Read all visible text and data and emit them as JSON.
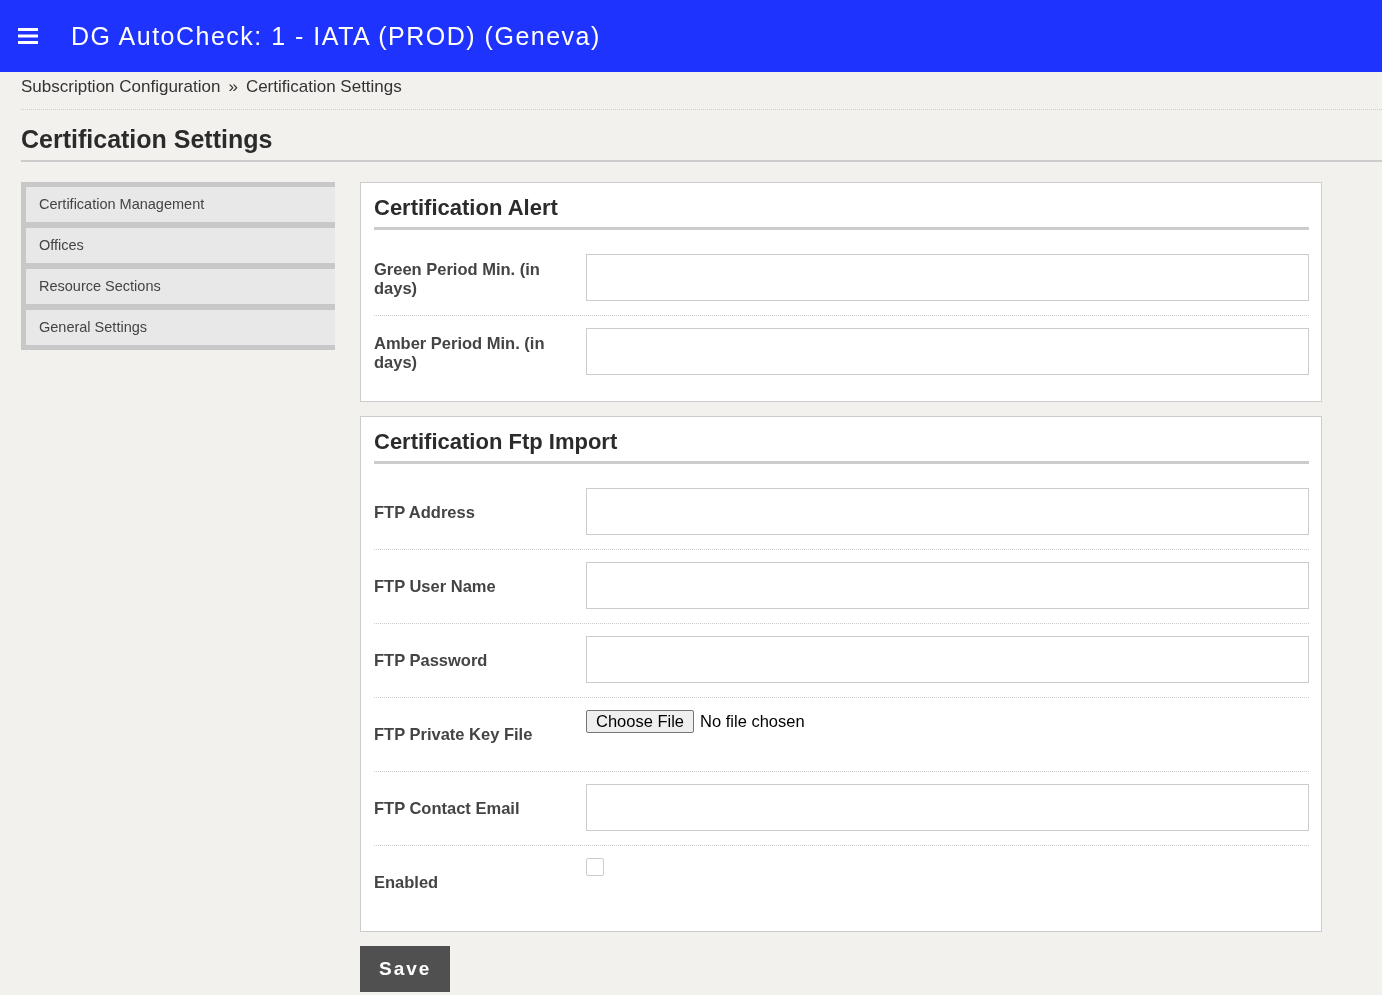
{
  "header": {
    "title": "DG AutoCheck: 1 - IATA (PROD) (Geneva)"
  },
  "breadcrumb": [
    {
      "label": "Subscription Configuration"
    },
    {
      "label": "»"
    },
    {
      "label": "Certification Settings"
    }
  ],
  "page_title": "Certification Settings",
  "sidebar": {
    "items": [
      {
        "label": "Certification Management"
      },
      {
        "label": "Offices"
      },
      {
        "label": "Resource Sections"
      },
      {
        "label": "General Settings"
      }
    ]
  },
  "sections": [
    {
      "title": "Certification Alert",
      "fields": [
        {
          "kind": "text",
          "label": "Green Period Min. (in days)"
        },
        {
          "kind": "text",
          "label": "Amber Period Min. (in days)"
        }
      ]
    },
    {
      "title": "Certification Ftp Import",
      "fields": [
        {
          "kind": "text",
          "label": "FTP Address"
        },
        {
          "kind": "text",
          "label": "FTP User Name"
        },
        {
          "kind": "text",
          "label": "FTP Password"
        },
        {
          "kind": "file",
          "label": "FTP Private Key File",
          "button": "Choose File",
          "status": "No file chosen"
        },
        {
          "kind": "text",
          "label": "FTP Contact Email"
        },
        {
          "kind": "checkbox",
          "label": "Enabled",
          "checked": false
        }
      ]
    }
  ],
  "save_button": "Save"
}
